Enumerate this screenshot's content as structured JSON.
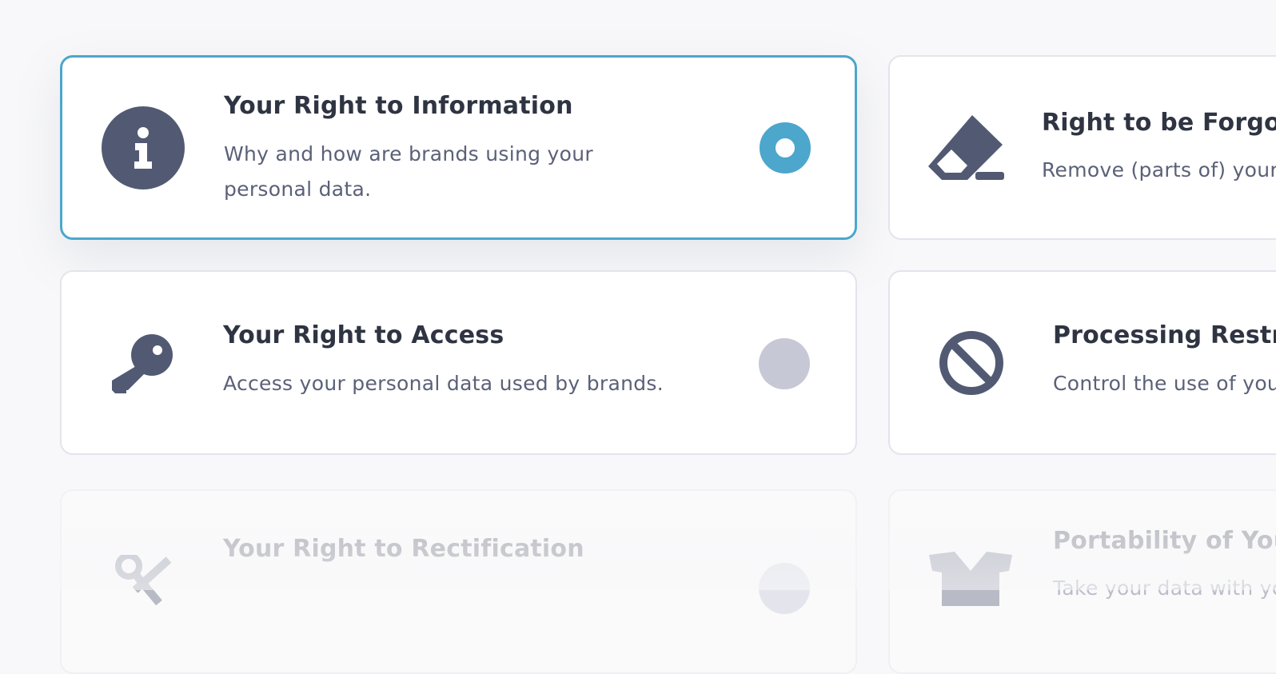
{
  "cards": [
    {
      "title": "Your Right to Information",
      "description_line1": "Why and how are brands using your",
      "description_line2": "personal data.",
      "icon": "info-icon",
      "state": "selected"
    },
    {
      "title": "Right to be Forgotten",
      "description_line1": "Remove (parts of) your",
      "description_line2": "",
      "icon": "eraser-icon",
      "state": "unselected"
    },
    {
      "title": "Your Right to Access",
      "description_line1": "Access your personal data used by brands.",
      "description_line2": "",
      "icon": "key-icon",
      "state": "unselected"
    },
    {
      "title": "Processing Restriction",
      "description_line1": "Control the use of your",
      "description_line2": "",
      "icon": "ban-icon",
      "state": "unselected"
    },
    {
      "title": "Your Right to Rectification",
      "description_line1": "",
      "description_line2": "",
      "icon": "tools-icon",
      "state": "faded"
    },
    {
      "title": "Portability of Your Data",
      "description_line1": "Take your data with you",
      "description_line2": "",
      "icon": "box-icon",
      "state": "faded"
    }
  ],
  "colors": {
    "accent": "#4da6cb",
    "icon": "#525a73",
    "radio_off": "#c6c8d6",
    "border": "#e3e4ec"
  }
}
